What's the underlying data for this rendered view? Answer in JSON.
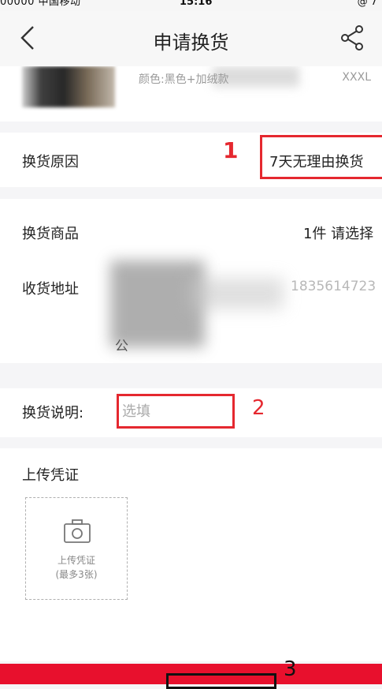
{
  "status_bar": {
    "carrier": "00000 中国移动",
    "time": "15:16",
    "battery": "@ 7"
  },
  "header": {
    "title": "申请换货"
  },
  "product": {
    "spec_label": "颜色:黑色+加绒款",
    "size": "XXXL"
  },
  "exchange_reason": {
    "label": "换货原因",
    "value": "7天无理由换货"
  },
  "exchange_goods": {
    "label": "换货商品",
    "value": "1件 请选择"
  },
  "address": {
    "label": "收货地址",
    "phone": "1835614723",
    "line_tail": "公"
  },
  "note": {
    "label": "换货说明:",
    "placeholder": "选填"
  },
  "upload": {
    "title": "上传凭证",
    "box_line1": "上传凭证",
    "box_line2": "(最多3张)"
  },
  "annotations": {
    "mark1": "1",
    "mark2": "2",
    "mark3": "3"
  },
  "colors": {
    "accent": "#e8102d",
    "annotation": "#e5282f"
  },
  "icons": {
    "back": "chevron-left-icon",
    "share": "share-icon",
    "camera": "camera-icon"
  }
}
